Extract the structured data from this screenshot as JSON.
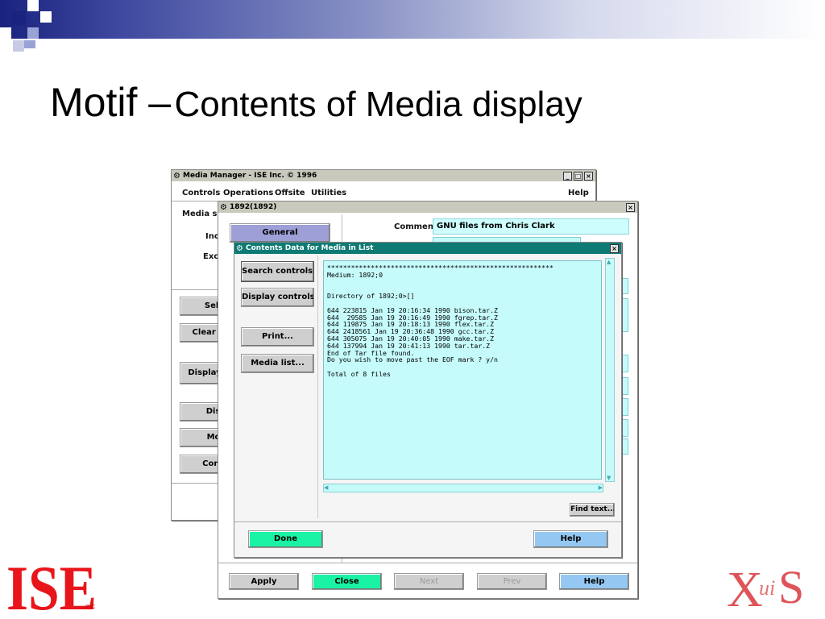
{
  "slide": {
    "title_main": "Motif –",
    "title_sub": "Contents of Media display"
  },
  "colors": {
    "header_dark": "#1a237e",
    "field_cyan": "#cdfdfd",
    "done_green": "#19f3a3",
    "help_blue": "#94c8f2",
    "title_teal": "#0e7a74"
  },
  "main_window": {
    "title": "Media Manager - ISE Inc. © 1996",
    "menu": [
      "Controls",
      "Operations",
      "Offsite",
      "Utilities"
    ],
    "help": "Help",
    "media_label": "Media sel",
    "inc_label": "Inc",
    "exc_label": "Exc",
    "buttons": [
      "Selec",
      "Clear se",
      "Display c",
      "Displ",
      "Modi",
      "Conte"
    ]
  },
  "record_window": {
    "title": "1892(1892)",
    "general": "General",
    "comment_label": "Comment",
    "comment_value": "GNU files from Chris Clark",
    "bottom_buttons": {
      "apply": "Apply",
      "close": "Close",
      "next": "Next",
      "prev": "Prev",
      "help": "Help"
    }
  },
  "contents_window": {
    "title": "Contents Data for Media in List",
    "side_buttons": [
      "Search controls...",
      "Display controls...",
      "Print...",
      "Media list..."
    ],
    "text": "*********************************************************\nMedium: 1892;0\n\n\nDirectory of 1892;0>[]\n\n644 223815 Jan 19 20:16:34 1990 bison.tar.Z\n644  29585 Jan 19 20:16:49 1990 fgrep.tar.Z\n644 119875 Jan 19 20:18:13 1990 flex.tar.Z\n644 2418561 Jan 19 20:36:48 1990 gcc.tar.Z\n644 305075 Jan 19 20:40:05 1990 make.tar.Z\n644 137994 Jan 19 20:41:13 1990 tar.tar.Z\nEnd of Tar file found.\nDo you wish to move past the EOF mark ? y/n\n\nTotal of 8 files",
    "find_text": "Find text...",
    "done": "Done",
    "help": "Help"
  },
  "logos": {
    "ise": "ISE",
    "ise_small": "INC",
    "xus": "XuiS"
  }
}
